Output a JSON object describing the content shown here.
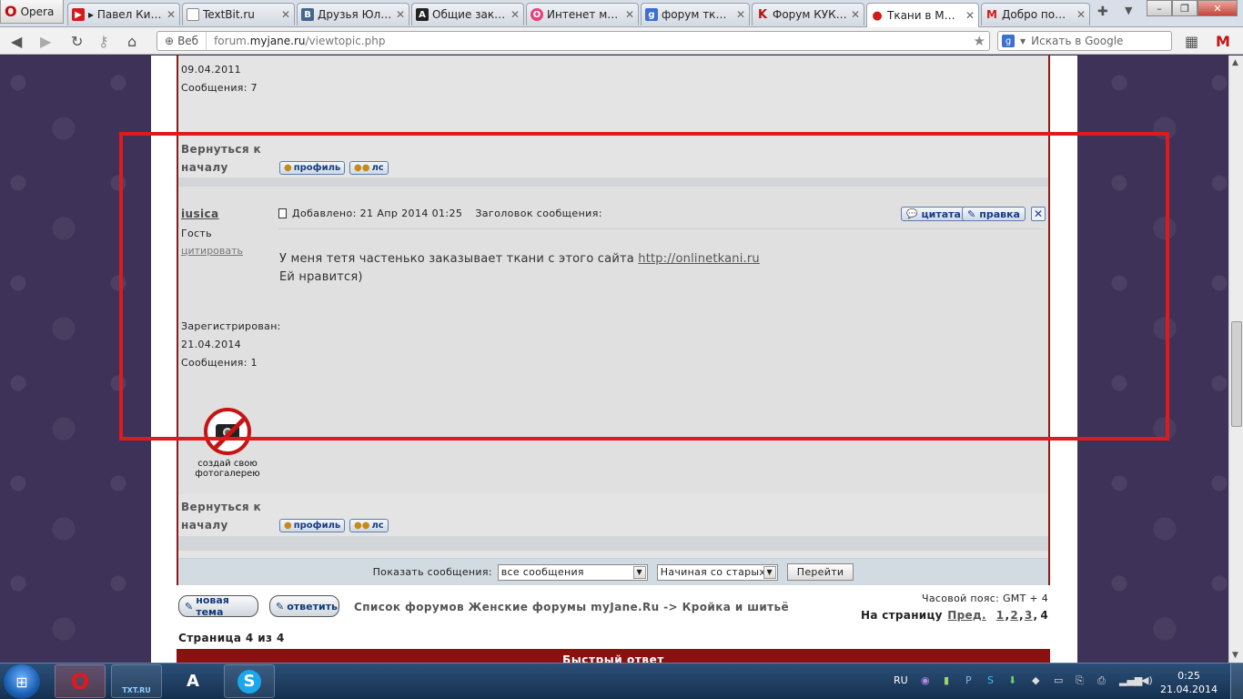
{
  "browser": {
    "menu_label": "Opera",
    "tabs": [
      {
        "title": "▸ Павел Кисе…",
        "icon_color": "#d21b1b",
        "icon_char": "▶"
      },
      {
        "title": "TextBit.ru",
        "icon_color": "#ffffff",
        "icon_char": ""
      },
      {
        "title": "Друзья Юлии…",
        "icon_color": "#45668e",
        "icon_char": "B"
      },
      {
        "title": "Общие заказ…",
        "icon_color": "#222222",
        "icon_char": "A"
      },
      {
        "title": "Интенет мага…",
        "icon_color": "#e8407a",
        "icon_char": "O"
      },
      {
        "title": "форум ткани…",
        "icon_color": "#3b6fd0",
        "icon_char": "g"
      },
      {
        "title": "Форум КУКЛ…",
        "icon_color": "#ffffff",
        "icon_char": "K"
      },
      {
        "title": "Ткани в Мос…",
        "icon_color": "#d21b1b",
        "icon_char": "●"
      },
      {
        "title": "Добро пожа…",
        "icon_color": "#ffffff",
        "icon_char": "M"
      }
    ],
    "address": {
      "web_label": "Веб",
      "url_prefix": "forum.",
      "url_host": "myjane.ru",
      "url_path": "/viewtopic.php"
    },
    "search_placeholder": "Искать в Google"
  },
  "prev_post": {
    "reg_date": "09.04.2011",
    "messages": "Сообщения: 7",
    "back_to_top": "Вернуться к началу",
    "profile_btn": "профиль",
    "pm_btn": "лс"
  },
  "post": {
    "author": "iusica",
    "role": "Гость",
    "quote_link": "цитировать",
    "registered_label": "Зарегистрирован:",
    "registered_date": "21.04.2014",
    "messages": "Сообщения: 1",
    "gallery_caption": "создай свою фотогалерею",
    "added_label": "Добавлено: 21 Апр 2014 01:25",
    "subject_label": "Заголовок сообщения:",
    "quote_btn": "цитата",
    "edit_btn": "правка",
    "body_line1": "У меня тетя частенько заказывает ткани с этого сайта ",
    "body_link": "http://onlinetkani.ru",
    "body_line2": "Ей нравится)",
    "back_to_top": "Вернуться к началу",
    "profile_btn": "профиль",
    "pm_btn": "лс"
  },
  "footer": {
    "show_label": "Показать сообщения:",
    "filter_value": "все сообщения",
    "order_value": "Начиная со старых",
    "go_btn": "Перейти",
    "new_topic_btn": "новая тема",
    "reply_btn": "ответить",
    "breadcrumb": "Список форумов Женские форумы myJane.Ru -> Кройка и шитьё",
    "timezone": "Часовой пояс: GMT + 4",
    "pages_label": "На страницу",
    "prev_link": "Пред.",
    "pages": [
      "1",
      "2",
      "3"
    ],
    "current_page": "4",
    "page_of": "Страница 4 из 4",
    "quick_reply": "Быстрый ответ"
  },
  "taskbar": {
    "apps": [
      "O",
      "TXT.RU",
      "A",
      "S"
    ],
    "lang": "RU",
    "time": "0:25",
    "date": "21.04.2014"
  },
  "colors": {
    "forum_border": "#8b1a1a",
    "highlight": "#e01a1a",
    "button_text": "#1a3c80"
  }
}
